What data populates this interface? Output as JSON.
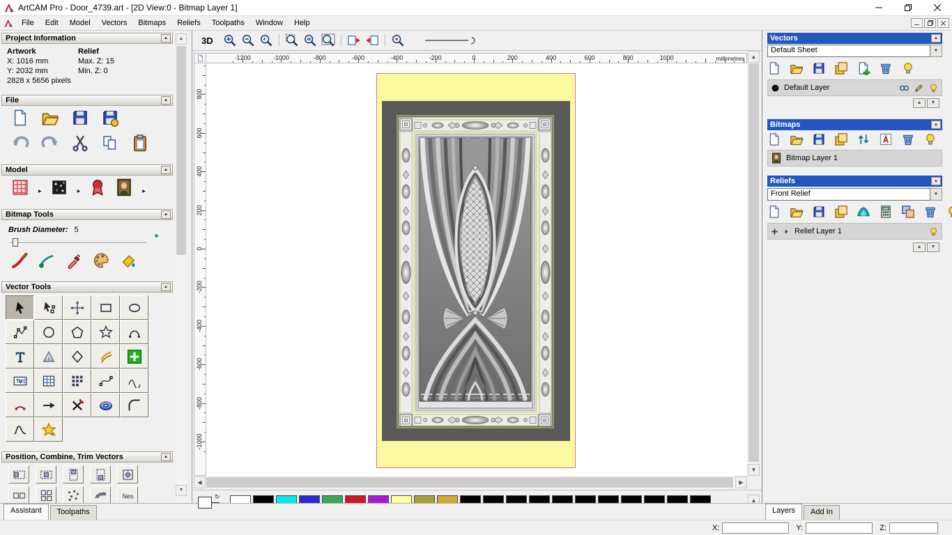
{
  "window": {
    "title": "ArtCAM Pro - Door_4739.art - [2D View:0 - Bitmap Layer 1]"
  },
  "menu": {
    "items": [
      "File",
      "Edit",
      "Model",
      "Vectors",
      "Bitmaps",
      "Reliefs",
      "Toolpaths",
      "Window",
      "Help"
    ]
  },
  "assistant": {
    "project_information": {
      "title": "Project Information",
      "artwork_heading": "Artwork",
      "relief_heading": "Relief",
      "artwork_x": "X: 1016 mm",
      "artwork_y": "Y: 2032 mm",
      "artwork_pixels": "2828 x 5656 pixels",
      "relief_max_z": "Max. Z: 15",
      "relief_min_z": "Min. Z: 0"
    },
    "file": {
      "title": "File",
      "row1": [
        "new-model",
        "open-model",
        "save-model",
        "save-copy"
      ],
      "row2": [
        "undo",
        "redo",
        "cut",
        "copy",
        "paste"
      ]
    },
    "model": {
      "title": "Model",
      "icons": [
        "adjust-model",
        "greyscale-model",
        "stamp-model",
        "load-bitmap"
      ]
    },
    "bitmap_tools": {
      "title": "Bitmap Tools",
      "brush_label": "Brush Diameter:",
      "brush_value": "5",
      "icons": [
        "paint-brush",
        "draw-vector",
        "colour-picker",
        "palette",
        "flood-fill"
      ]
    },
    "vector_tools": {
      "title": "Vector Tools",
      "grid": [
        [
          "select-vectors",
          "node-editing",
          "transform-vectors",
          "create-rectangle",
          "create-ellipse"
        ],
        [
          "create-polyline",
          "create-circle",
          "create-polygon",
          "create-star",
          "create-arc"
        ],
        [
          "create-text",
          "measure",
          "create-diamond",
          "offset-vector",
          "paste-vector"
        ],
        [
          "text-in-box",
          "make-grid",
          "block-copy",
          "fit-curve",
          "smooth-polyline"
        ],
        [
          "join-close",
          "join-move",
          "trim-vectors",
          "spin-3d",
          "fillet"
        ],
        [
          "section-profile",
          "vector-doctor"
        ]
      ]
    },
    "position_tools": {
      "title": "Position, Combine, Trim Vectors",
      "row1": [
        "align-left",
        "align-centre",
        "align-top",
        "align-bottom",
        "centre-in-page"
      ],
      "row2": [
        "block-1",
        "block-2",
        "scatter",
        "paste-along",
        "nesting"
      ]
    },
    "tabs": [
      {
        "label": "Assistant",
        "active": true
      },
      {
        "label": "Toolpaths",
        "active": false
      }
    ]
  },
  "view": {
    "toolbar": {
      "label_3d": "3D",
      "icons": [
        "zoom-in",
        "zoom-out",
        "zoom-previous",
        "divider",
        "zoom-window",
        "zoom-1to1",
        "zoom-fit",
        "divider",
        "snap-left",
        "snap-right",
        "divider",
        "zoom-objects"
      ]
    },
    "ruler": {
      "unit": "millimetres",
      "h_labels": [
        -1200,
        -1000,
        -800,
        -600,
        -400,
        -200,
        0,
        200,
        400,
        600,
        800,
        1000
      ],
      "v_labels": [
        800,
        600,
        400,
        200,
        0,
        -200,
        -400,
        -600,
        -800,
        -1000
      ]
    },
    "palette": {
      "foreground": "#ffffff",
      "background": "#000000",
      "swatches": [
        "#ffffff",
        "#000000",
        "#00e8e8",
        "#2a2ad0",
        "#3aa85a",
        "#d01428",
        "#a81ad0",
        "#ffffa0",
        "#a8a040",
        "#d4a832",
        "#000000",
        "#000000",
        "#000000",
        "#000000",
        "#000000",
        "#000000",
        "#000000",
        "#000000",
        "#000000",
        "#000000",
        "#000000"
      ]
    }
  },
  "layers_panel": {
    "vectors": {
      "title": "Vectors",
      "sheet_select": "Default Sheet",
      "icons": [
        "new-page",
        "open-file",
        "save-file",
        "sheets",
        "new-layer",
        "delete-layer",
        "toggle-visibility"
      ],
      "layer": {
        "name": "Default Layer",
        "colour": "#000000",
        "icons": [
          "merge-layer",
          "edit-layer",
          "layer-visible"
        ]
      }
    },
    "bitmaps": {
      "title": "Bitmaps",
      "icons": [
        "new-page",
        "open-file",
        "save-file",
        "sheets",
        "swap-layer",
        "adjust-colour",
        "delete-layer",
        "toggle-visibility"
      ],
      "layer": {
        "name": "Bitmap Layer 1"
      }
    },
    "reliefs": {
      "title": "Reliefs",
      "relief_select": "Front Relief",
      "icons": [
        "new-page",
        "open-file",
        "save-file",
        "sheets",
        "relief-3d",
        "calculate",
        "combine",
        "delete-layer",
        "toggle-visibility"
      ],
      "layer": {
        "name": "Relief Layer 1"
      }
    },
    "tabs": [
      {
        "label": "Layers",
        "active": true
      },
      {
        "label": "Add In",
        "active": false
      }
    ]
  },
  "status_bar": {
    "x_label": "X:",
    "y_label": "Y:",
    "z_label": "Z:",
    "x_value": "",
    "y_value": "",
    "z_value": ""
  }
}
